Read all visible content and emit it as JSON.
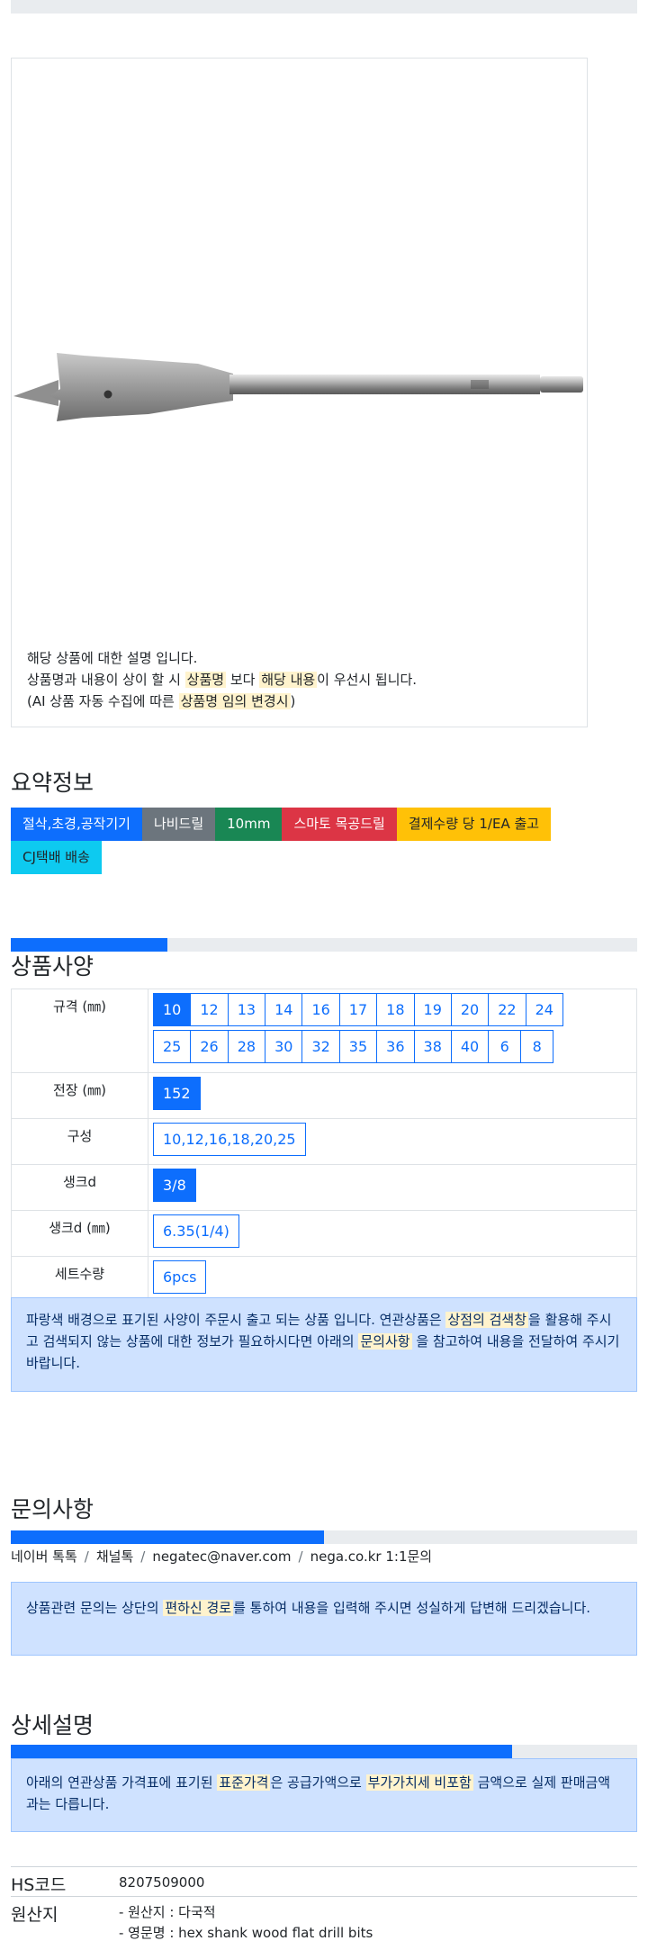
{
  "card": {
    "image_alt": "hex shank wood flat drill bit",
    "line1": "해당 상품에 대한 설명 입니다.",
    "line2_a": "상품명과 내용이 상이 할 시 ",
    "line2_hl1": "상품명",
    "line2_b": " 보다 ",
    "line2_hl2": "해당 내용",
    "line2_c": "이 우선시 됩니다.",
    "line3_a": "(AI 상품 자동 수집에 따른 ",
    "line3_hl": "상품명 임의 변경시",
    "line3_b": ")"
  },
  "summary": {
    "title": "요약정보",
    "badges": [
      "절삭,초경,공작기기",
      "나비드릴",
      "10mm",
      "스마토 목공드릴",
      "결제수량 당 1/EA 출고",
      "CJ택배 배송"
    ]
  },
  "spec": {
    "title": "상품사양",
    "progress": 0.25,
    "rows": [
      {
        "label": "규격 (㎜)",
        "options": [
          "10",
          "12",
          "13",
          "14",
          "16",
          "17",
          "18",
          "19",
          "20",
          "22",
          "24",
          "25",
          "26",
          "28",
          "30",
          "32",
          "35",
          "36",
          "38",
          "40",
          "6",
          "8"
        ],
        "selected": "10"
      },
      {
        "label": "전장 (㎜)",
        "options": [
          "152"
        ],
        "selected": "152"
      },
      {
        "label": "구성",
        "options": [
          "10,12,16,18,20,25"
        ],
        "selected": ""
      },
      {
        "label": "생크d",
        "options": [
          "3/8"
        ],
        "selected": "3/8"
      },
      {
        "label": "생크d (㎜)",
        "options": [
          "6.35(1/4)"
        ],
        "selected": ""
      },
      {
        "label": "세트수량",
        "options": [
          "6pcs"
        ],
        "selected": ""
      }
    ],
    "note_a": "파랑색 배경으로 표기된 사양이 주문시 출고 되는 상품 입니다. 연관상품은 ",
    "note_hl1": "상점의 검색창",
    "note_b": "을 활용해 주시고 검색되지 않는 상품에 대한 정보가 필요하시다면 아래의 ",
    "note_hl2": "문의사항",
    "note_c": " 을 참고하여 내용을 전달하여 주시기 바랍니다."
  },
  "inquiry": {
    "title": "문의사항",
    "progress": 0.5,
    "channels": [
      "네이버 톡톡",
      "채널톡",
      "negatec@naver.com",
      "nega.co.kr 1:1문의"
    ],
    "note_a": "상품관련 문의는 상단의 ",
    "note_hl": "편하신 경로",
    "note_b": "를 통하여 내용을 입력해 주시면 성실하게 답변해 드리겠습니다."
  },
  "detail": {
    "title": "상세설명",
    "progress": 0.8,
    "note_a": "아래의 연관상품 가격표에 표기된 ",
    "note_hl1": "표준가격",
    "note_b": "은 공급가액으로 ",
    "note_hl2": "부가가치세 비포함",
    "note_c": " 금액으로 실제 판매금액과는 다릅니다."
  },
  "info": {
    "hs_label": "HS코드",
    "hs_value": "8207509000",
    "origin_label": "원산지",
    "origin_line1": "- 원산지 : 다국적",
    "origin_line2": "- 영문명 : hex shank wood flat drill bits"
  }
}
